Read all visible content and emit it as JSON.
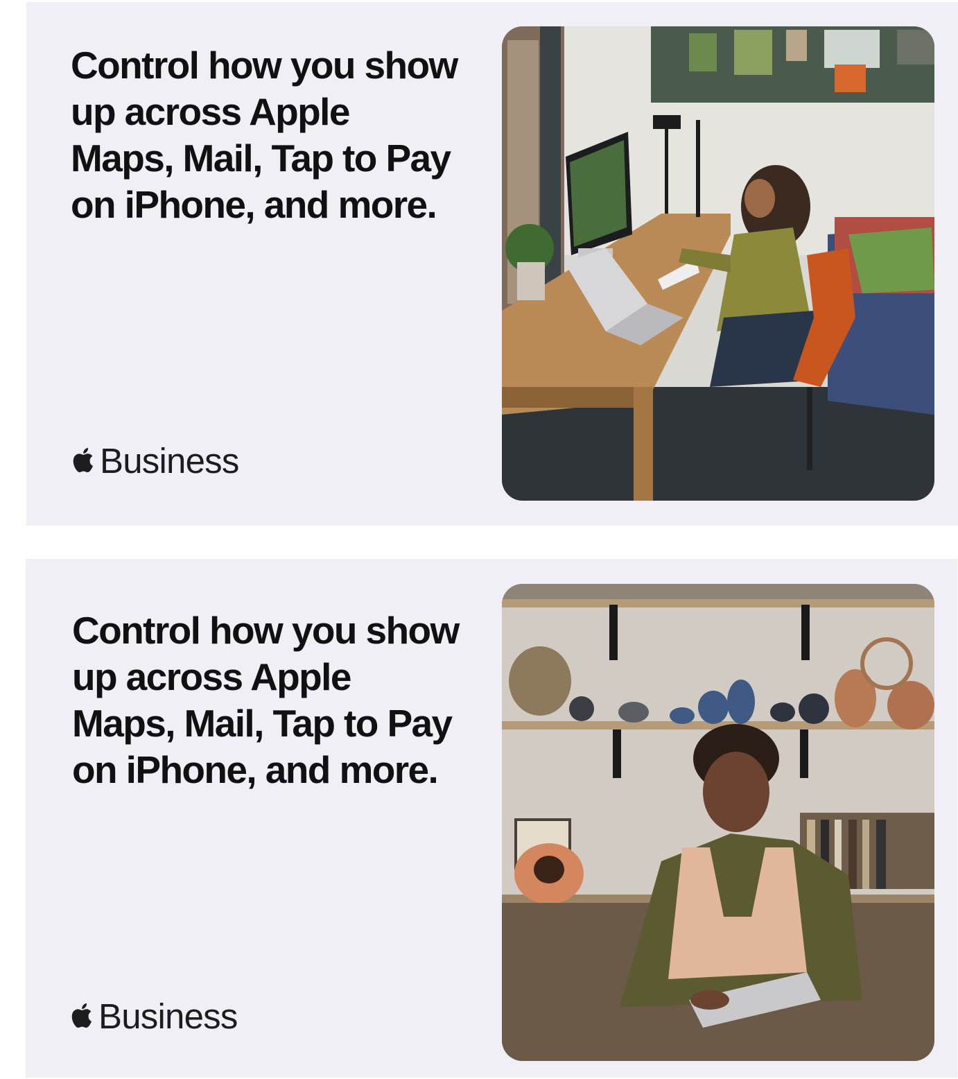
{
  "cards": [
    {
      "headline": "Control how you show up across Apple Maps, Mail, Tap to Pay on iPhone, and more.",
      "brand": {
        "logo_icon": "apple-logo-icon",
        "label": "Business"
      },
      "photo": {
        "subject": "woman-at-desk-photo"
      }
    },
    {
      "headline": "Control how you show up across Apple Maps, Mail, Tap to Pay on iPhone, and more.",
      "brand": {
        "logo_icon": "apple-logo-icon",
        "label": "Business"
      },
      "photo": {
        "subject": "man-with-ipad-photo"
      }
    }
  ],
  "colors": {
    "card_background": "#efeff5",
    "headline_text": "#111113"
  }
}
